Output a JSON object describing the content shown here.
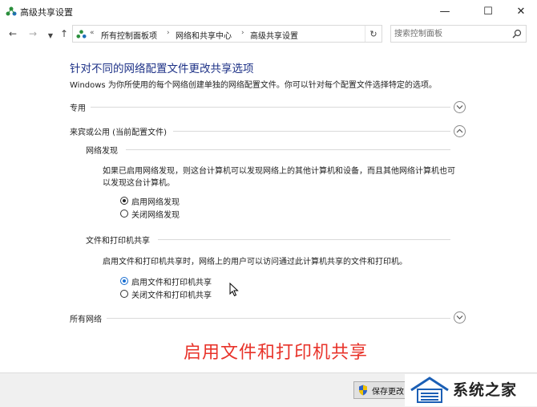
{
  "window": {
    "title": "高级共享设置",
    "minimize": "—",
    "maximize": "☐",
    "close": "✕"
  },
  "nav": {
    "back": "←",
    "forward": "→",
    "history": "▼",
    "up": "↑",
    "breadcrumb_prefix": "«",
    "breadcrumb": [
      "所有控制面板项",
      "网络和共享中心",
      "高级共享设置"
    ],
    "breadcrumb_sep": "›",
    "refresh": "↻",
    "search_placeholder": "搜索控制面板"
  },
  "content": {
    "heading": "针对不同的网络配置文件更改共享选项",
    "description": "Windows 为你所使用的每个网络创建单独的网络配置文件。你可以针对每个配置文件选择特定的选项。",
    "sections": {
      "private": {
        "label": "专用",
        "expanded": false
      },
      "guest_public": {
        "label": "来宾或公用 (当前配置文件)",
        "expanded": true
      },
      "all_networks": {
        "label": "所有网络",
        "expanded": false
      }
    },
    "network_discovery": {
      "heading": "网络发现",
      "paragraph": "如果已启用网络发现，则这台计算机可以发现网络上的其他计算机和设备，而且其他网络计算机也可以发现这台计算机。",
      "options": [
        {
          "label": "启用网络发现",
          "checked": true
        },
        {
          "label": "关闭网络发现",
          "checked": false
        }
      ]
    },
    "file_printer_sharing": {
      "heading": "文件和打印机共享",
      "paragraph": "启用文件和打印机共享时，网络上的用户可以访问通过此计算机共享的文件和打印机。",
      "options": [
        {
          "label": "启用文件和打印机共享",
          "checked": true
        },
        {
          "label": "关闭文件和打印机共享",
          "checked": false
        }
      ]
    }
  },
  "overlay_caption": "启用文件和打印机共享",
  "footer": {
    "save_button": "保存更改"
  },
  "watermark": {
    "text": "系统之家"
  },
  "colors": {
    "heading": "#1e3287",
    "caption_red": "#e8332a",
    "radio_blue": "#1a6fd1"
  }
}
